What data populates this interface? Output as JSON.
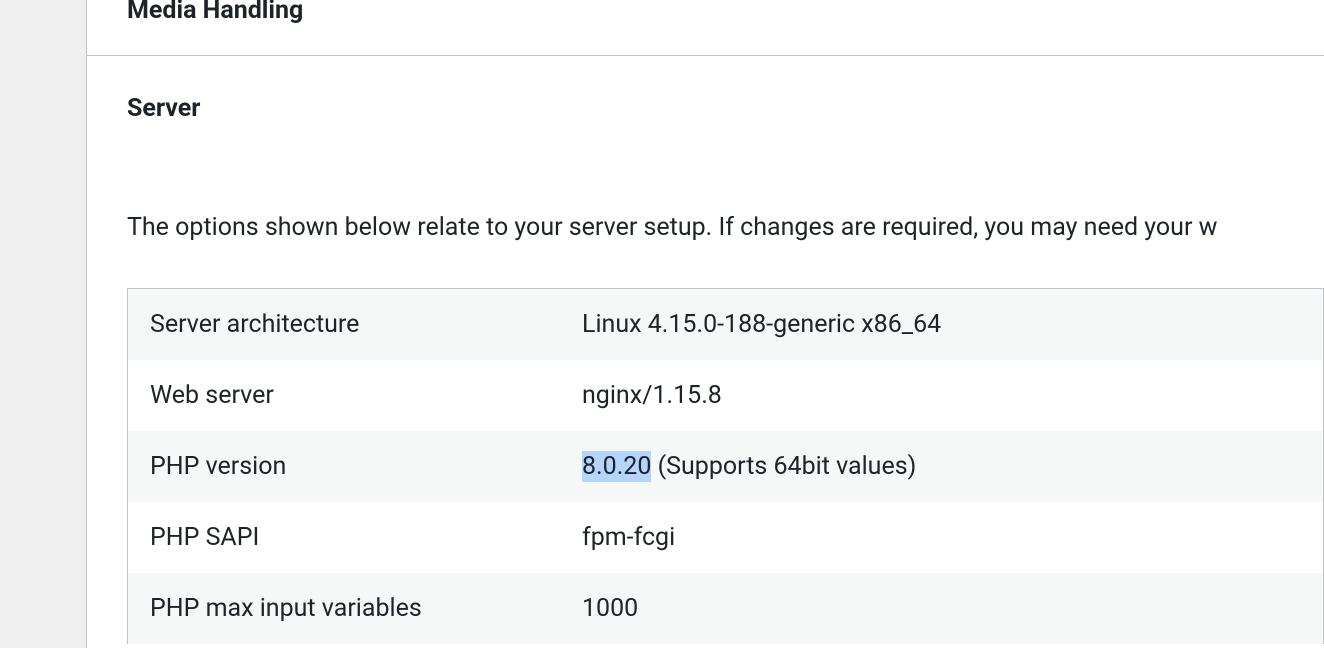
{
  "sections": {
    "media_handling": {
      "title": "Media Handling"
    },
    "server": {
      "title": "Server",
      "description": "The options shown below relate to your server setup. If changes are required, you may need your w"
    }
  },
  "server_info": {
    "rows": [
      {
        "label": "Server architecture",
        "value": "Linux 4.15.0-188-generic x86_64"
      },
      {
        "label": "Web server",
        "value": "nginx/1.15.8"
      },
      {
        "label": "PHP version",
        "value_highlight": "8.0.20",
        "value_rest": " (Supports 64bit values)"
      },
      {
        "label": "PHP SAPI",
        "value": "fpm-fcgi"
      },
      {
        "label": "PHP max input variables",
        "value": "1000"
      }
    ]
  }
}
